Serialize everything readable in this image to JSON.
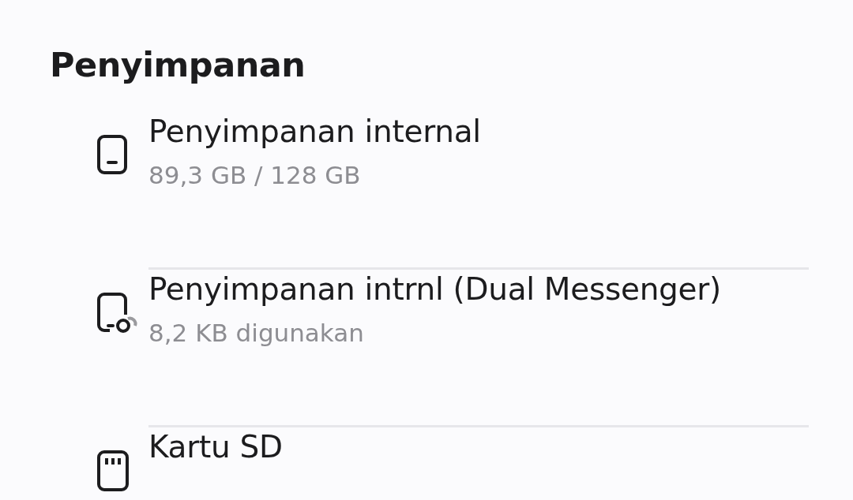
{
  "title": "Penyimpanan",
  "items": [
    {
      "kind": "phone",
      "name": "Penyimpanan internal",
      "detail": "89,3 GB / 128 GB"
    },
    {
      "kind": "dual-phone",
      "name": "Penyimpanan intrnl (Dual Messenger)",
      "detail": "8,2 KB digunakan"
    },
    {
      "kind": "sd-card",
      "name": "Kartu SD"
    }
  ]
}
